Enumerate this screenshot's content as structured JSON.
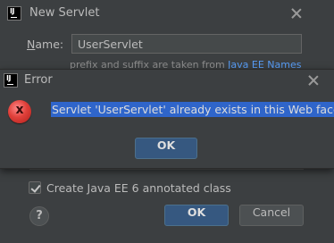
{
  "servlet_dialog": {
    "title": "New Servlet",
    "name_label_mnemonic": "N",
    "name_label_rest": "ame:",
    "name_value": "UserServlet",
    "hint_text": "prefix and suffix are taken from",
    "hint_link": "Java EE Names",
    "annotated_checkbox_label": "Create Java EE 6 annotated class",
    "annotated_checked": true,
    "help_label": "?",
    "ok_label": "OK",
    "cancel_label": "Cancel"
  },
  "error_dialog": {
    "title": "Error",
    "message": "Servlet 'UserServlet' already exists in this Web facet.",
    "ok_label": "OK"
  },
  "icons": {
    "app": "intellij-icon",
    "close": "close-icon",
    "error": "error-icon"
  },
  "colors": {
    "background": "#3c3f41",
    "default_button": "#365880",
    "selection": "#2f65ca",
    "link": "#589df6",
    "error_red": "#e0403a"
  }
}
